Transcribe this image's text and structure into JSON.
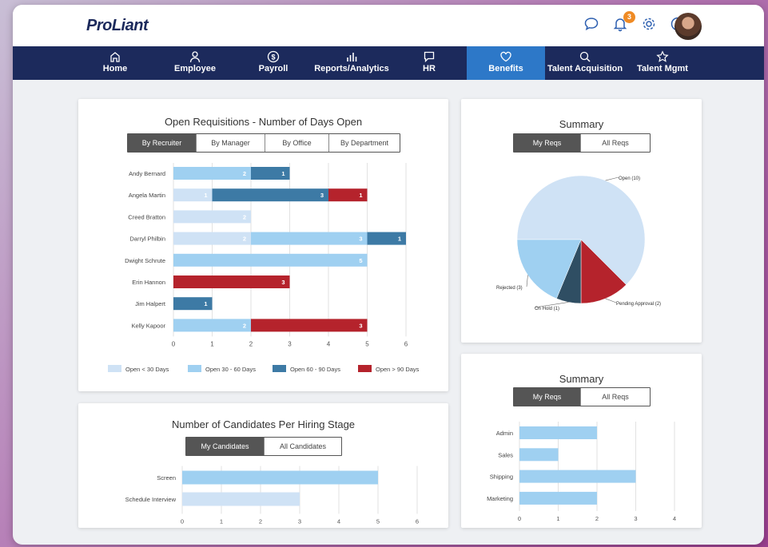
{
  "brand": {
    "logo": "ProLiant"
  },
  "topbar": {
    "notification_count": "3"
  },
  "nav": [
    {
      "label": "Home",
      "icon": "home-icon"
    },
    {
      "label": "Employee",
      "icon": "person-icon"
    },
    {
      "label": "Payroll",
      "icon": "dollar-icon"
    },
    {
      "label": "Reports/Analytics",
      "icon": "bar-chart-icon"
    },
    {
      "label": "HR",
      "icon": "chat-icon"
    },
    {
      "label": "Benefits",
      "icon": "heart-icon"
    },
    {
      "label": "Talent Acquisition",
      "icon": "search-icon"
    },
    {
      "label": "Talent Mgmt",
      "icon": "star-icon"
    }
  ],
  "colors": {
    "lt30": "#cfe2f5",
    "d30_60": "#9fd0f1",
    "d60_90": "#3d7aa5",
    "gt90": "#b5232c",
    "onhold": "#2f4e63"
  },
  "requisitions": {
    "title": "Open Requisitions - Number of Days Open",
    "tabs": [
      "By Recruiter",
      "By Manager",
      "By Office",
      "By Department"
    ],
    "legend": [
      "Open < 30 Days",
      "Open 30 - 60 Days",
      "Open 60 - 90 Days",
      "Open > 90 Days"
    ]
  },
  "summary1": {
    "title": "Summary",
    "tabs": [
      "My Reqs",
      "All Reqs"
    ]
  },
  "summary2": {
    "title": "Summary",
    "tabs": [
      "My Reqs",
      "All Reqs"
    ]
  },
  "candidates": {
    "title": "Number of Candidates Per Hiring Stage",
    "tabs": [
      "My Candidates",
      "All Candidates"
    ]
  },
  "chart_data": [
    {
      "type": "bar",
      "orientation": "horizontal-stacked",
      "title": "Open Requisitions - Number of Days Open",
      "categories": [
        "Andy Bernard",
        "Angela Martin",
        "Creed Bratton",
        "Darryl Philbin",
        "Dwight Schrute",
        "Erin Hannon",
        "Jim Halpert",
        "Kelly Kapoor"
      ],
      "series": [
        {
          "name": "Open < 30 Days",
          "values": [
            0,
            1,
            2,
            2,
            0,
            0,
            0,
            0
          ]
        },
        {
          "name": "Open 30 - 60 Days",
          "values": [
            2,
            0,
            0,
            3,
            5,
            0,
            0,
            2
          ]
        },
        {
          "name": "Open 60 - 90 Days",
          "values": [
            1,
            3,
            0,
            1,
            0,
            0,
            1,
            0
          ]
        },
        {
          "name": "Open > 90 Days",
          "values": [
            0,
            1,
            0,
            0,
            0,
            3,
            0,
            3
          ]
        }
      ],
      "ticks": [
        "0",
        "1",
        "2",
        "3",
        "4",
        "5",
        "6"
      ],
      "xlim": [
        0,
        6
      ]
    },
    {
      "type": "pie",
      "title": "Summary",
      "slices": [
        {
          "label": "Open (10)",
          "value": 10
        },
        {
          "label": "Pending Approval (2)",
          "value": 2
        },
        {
          "label": "On Hold (1)",
          "value": 1
        },
        {
          "label": "Rejected (3)",
          "value": 3
        }
      ]
    },
    {
      "type": "bar",
      "orientation": "horizontal",
      "title": "Summary",
      "categories": [
        "Admin",
        "Sales",
        "Shipping",
        "Marketing"
      ],
      "values": [
        2,
        1,
        3,
        2
      ],
      "ticks": [
        "0",
        "1",
        "2",
        "3",
        "4"
      ],
      "xlim": [
        0,
        4
      ]
    },
    {
      "type": "bar",
      "orientation": "horizontal",
      "title": "Number of Candidates Per Hiring Stage",
      "categories": [
        "Screen",
        "Schedule Interview"
      ],
      "values": [
        5,
        3
      ],
      "ticks": [
        "0",
        "1",
        "2",
        "3",
        "4",
        "5",
        "6"
      ],
      "xlim": [
        0,
        6
      ]
    }
  ]
}
